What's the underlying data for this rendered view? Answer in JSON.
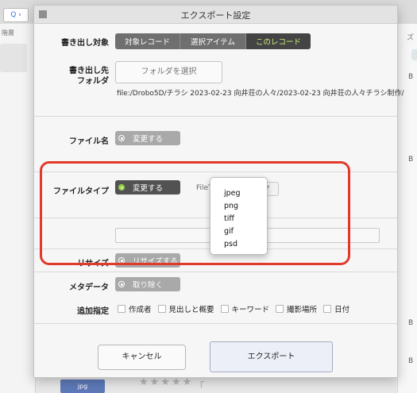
{
  "background": {
    "search_icon": "Q ›",
    "left_label": "階層",
    "right_label": "ズ",
    "right_marks": [
      "B",
      "B",
      "B",
      "B"
    ],
    "thumb_label": "jpg",
    "stars": "★★★★★ ┌"
  },
  "dialog": {
    "title": "エクスポート設定",
    "export_target": {
      "label": "書き出し対象",
      "options": [
        "対象レコード",
        "選択アイテム",
        "このレコード"
      ],
      "selected": "このレコード"
    },
    "export_dest": {
      "label_line1": "書き出し先",
      "label_line2": "フォルダ",
      "choose_button": "フォルダを選択",
      "path": "file:/Drobo5D/チラシ 2023-02-23 向井荘の人々/2023-02-23 向井荘の人々チラシ制作/"
    },
    "file_name": {
      "label": "ファイル名",
      "toggle_label": "変更する"
    },
    "file_type": {
      "label": "ファイルタイプ",
      "toggle_label": "変更する",
      "select_label": "FileTyp",
      "options": [
        "jpeg",
        "png",
        "tiff",
        "gif",
        "psd"
      ]
    },
    "resize": {
      "label": "リサイズ",
      "toggle_label": "リサイズする"
    },
    "metadata": {
      "label": "メタデータ",
      "toggle_label": "取り除く"
    },
    "additional": {
      "label": "追加指定",
      "options": [
        "作成者",
        "見出しと概要",
        "キーワード",
        "撮影場所",
        "日付"
      ]
    },
    "cancel_button": "キャンセル",
    "export_button": "エクスポート"
  },
  "colors": {
    "highlight_border": "#e23a2a",
    "active_segment_text": "#c9f07a",
    "toggle_on_dot": "#8ccd3f"
  }
}
